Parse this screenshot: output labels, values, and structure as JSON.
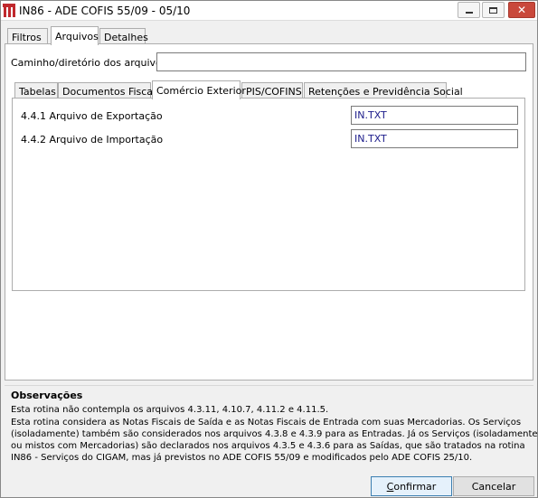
{
  "window": {
    "title": "IN86 - ADE COFIS 55/09 - 05/10",
    "minimize_glyph": "",
    "close_glyph": "✕"
  },
  "main_tabs": [
    {
      "label": "Filtros"
    },
    {
      "label": "Arquivos"
    },
    {
      "label": "Detalhes"
    }
  ],
  "path": {
    "label": "Caminho/diretório dos arquivos",
    "value": ""
  },
  "sub_tabs": [
    {
      "label": "Tabelas"
    },
    {
      "label": "Documentos Fiscais"
    },
    {
      "label": "Comércio Exterior"
    },
    {
      "label": "PIS/COFINS"
    },
    {
      "label": "Retenções e Previdência Social"
    }
  ],
  "comercio_exterior": {
    "export_label": "4.4.1 Arquivo de Exportação",
    "export_value": "IN.TXT",
    "import_label": "4.4.2 Arquivo de Importação",
    "import_value": "IN.TXT"
  },
  "observacoes": {
    "title": "Observações",
    "lines": [
      "Esta rotina não contempla os arquivos 4.3.11, 4.10.7, 4.11.2 e 4.11.5.",
      "Esta rotina considera as Notas Fiscais de Saída e as Notas Fiscais de Entrada com suas Mercadorias. Os Serviços",
      "(isoladamente) também são considerados nos arquivos 4.3.8 e 4.3.9 para as Entradas. Já os Serviços (isoladamente",
      "ou mistos com Mercadorias) são declarados nos arquivos 4.3.5 e 4.3.6 para as Saídas, que são tratados na rotina",
      "IN86 - Serviços do CIGAM, mas já previstos no ADE COFIS 55/09 e modificados pelo ADE COFIS 25/10."
    ]
  },
  "buttons": {
    "confirm_first": "C",
    "confirm_rest": "onfirmar",
    "cancel": "Cancelar"
  },
  "colors": {
    "icon": "#c0282d",
    "close_button": "#c9483b",
    "field_text": "#1b1b8a"
  }
}
